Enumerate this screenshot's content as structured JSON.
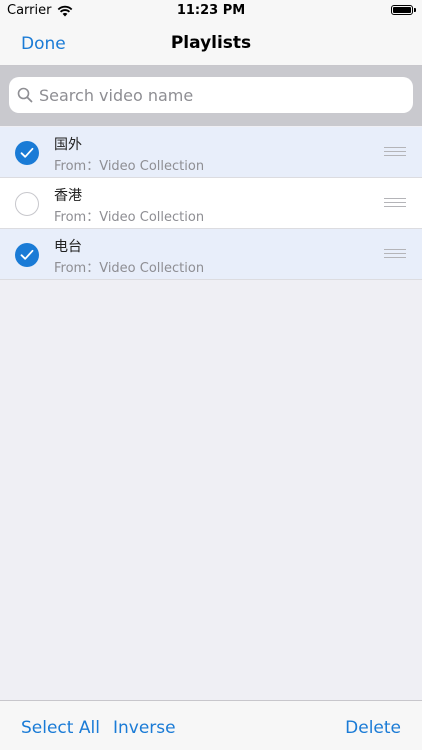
{
  "status_bar": {
    "carrier": "Carrier",
    "time": "11:23 PM"
  },
  "nav": {
    "done_label": "Done",
    "title": "Playlists"
  },
  "search": {
    "placeholder": "Search video name",
    "value": ""
  },
  "playlists": [
    {
      "title": "国外",
      "subtitle": "From：Video Collection",
      "selected": true
    },
    {
      "title": "香港",
      "subtitle": "From：Video Collection",
      "selected": false
    },
    {
      "title": "电台",
      "subtitle": "From：Video Collection",
      "selected": true
    }
  ],
  "toolbar": {
    "select_all_label": "Select All",
    "inverse_label": "Inverse",
    "delete_label": "Delete"
  },
  "colors": {
    "accent": "#1a7bd6",
    "selected_row": "#e8eefa",
    "background": "#efeff4"
  },
  "icons": {
    "wifi": "wifi-icon",
    "battery": "battery-icon",
    "search": "search-icon",
    "checkmark": "checkmark-icon",
    "reorder": "reorder-handle-icon"
  }
}
